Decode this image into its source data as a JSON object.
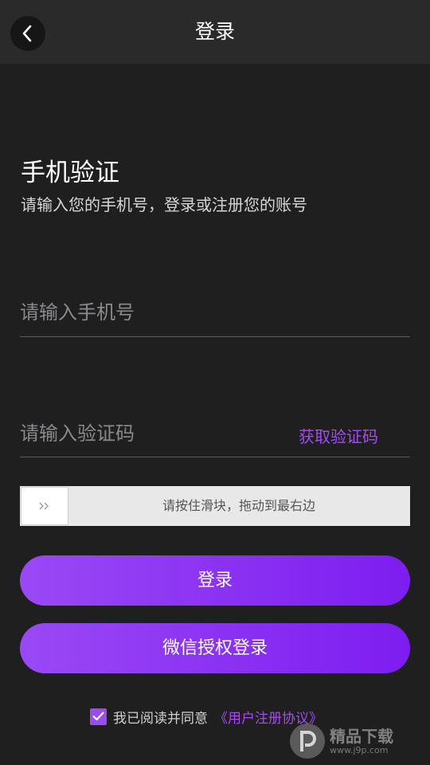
{
  "header": {
    "title": "登录",
    "back_icon": "chevron-left-icon"
  },
  "main": {
    "heading": "手机验证",
    "subheading": "请输入您的手机号，登录或注册您的账号",
    "phone_placeholder": "请输入手机号",
    "code_placeholder": "请输入验证码",
    "get_code_label": "获取验证码",
    "slider_text": "请按住滑块，拖动到最右边",
    "login_label": "登录",
    "wechat_login_label": "微信授权登录"
  },
  "agreement": {
    "checked": true,
    "text": "我已阅读并同意",
    "link": "《用户注册协议》"
  },
  "watermark": {
    "title": "精品下载",
    "url": "www.j9p.com"
  },
  "colors": {
    "accent": "#9a49f5",
    "link": "#a24cf2",
    "background": "#1f1f20",
    "header": "#2a2a2b"
  }
}
